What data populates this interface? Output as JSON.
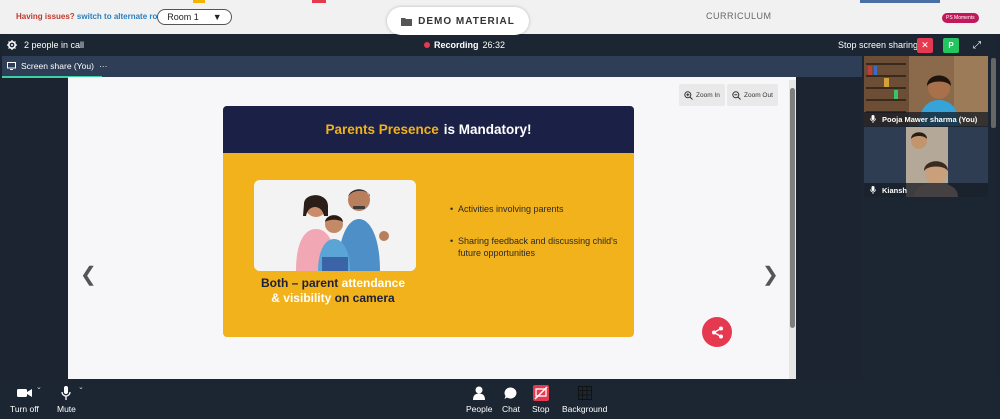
{
  "topbar": {
    "issue_text": "Having issues?",
    "switch_link": "switch to alternate room",
    "room_select": "Room 1",
    "demo_label": "DEMO MATERIAL",
    "curriculum_label": "CURRICULUM",
    "moments_badge": "PS Moments"
  },
  "call_header": {
    "people_count": "2 people in call",
    "recording_label": "Recording",
    "recording_time": "26:32",
    "stop_share_label": "Stop screen sharing",
    "p_button": "P"
  },
  "share_tab": {
    "label": "Screen share (You)",
    "more": "···"
  },
  "viewer": {
    "zoom_in": "Zoom In",
    "zoom_out": "Zoom Out"
  },
  "slide": {
    "title_highlight": "Parents Presence",
    "title_rest": "is Mandatory!",
    "caption_1": "Both – parent",
    "caption_2": "attendance",
    "caption_3": "& visibility",
    "caption_4": "on camera",
    "bullet_1": "Activities involving parents",
    "bullet_2": "Sharing feedback and discussing child's future opportunities"
  },
  "participants": [
    {
      "name": "Pooja Mawer sharma (You)"
    },
    {
      "name": "Kiansh"
    }
  ],
  "bottombar": {
    "turn_off": "Turn off",
    "mute": "Mute",
    "people": "People",
    "chat": "Chat",
    "stop": "Stop",
    "background": "Background"
  },
  "colors": {
    "accent_red": "#e53950",
    "slide_yellow": "#f2b21b",
    "slide_navy": "#1b2047",
    "green": "#22c55e"
  }
}
